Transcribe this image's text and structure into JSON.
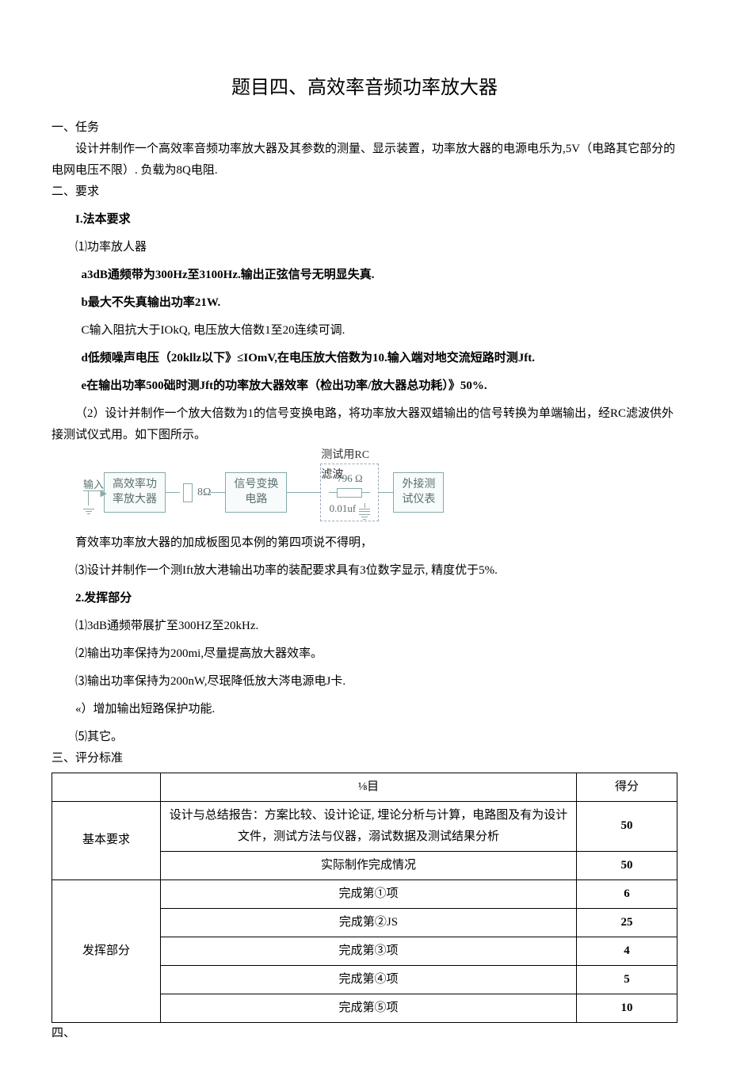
{
  "title": "题目四、高效率音频功率放大器",
  "s1": {
    "head": "一、任务",
    "p1": "设计并制作一个高效率音频功率放大器及其参数的测量、显示装置，功率放大器的电源电乐为,5V（电路其它部分的电网电压不限）. 负载为8Q电阻."
  },
  "s2": {
    "head": "二、要求",
    "basic": "I.法本要求",
    "i1": "⑴功率放人器",
    "a": "a3dB通频带为300Hz至3100Hz.输出正弦信号无明显失真.",
    "b": "b最大不失真输出功率21W.",
    "c": "C输入阻抗大于IOkQ, 电压放大倍数1至20连续可调.",
    "d": "d低频噪声电压（20kllz以下》≤IOmV,在电压放大倍数为10.输入端对地交流短路时测Jft.",
    "e": "e在输出功率500础时测Jft的功率放大器效率（检出功率/放大器总功耗）》50%.",
    "i2": "（2）设计并制作一个放大倍数为1的信号变换电路，将功率放大器双蜡输出的信号转换为单端输出，经RC滤波供外接测试仪式用。如下图所示。",
    "diag_note": "育效率功率放大器的加成板图见本例的第四项说不得明，",
    "i3": "⑶设计并制作一个测Ift放大港输出功率的装配要求具有3位数字显示, 精度优于5%.",
    "ext": "2.发挥部分",
    "e1": "⑴3dB通频带展扩至300HZ至20kHz.",
    "e2": "⑵输出功率保持为200mi,尽量提高放大器效率。",
    "e3": "⑶输出功率保持为200nW,尽珉降低放大涔电源电J卡.",
    "e4": "«）增加输出短路保护功能.",
    "e5": "⑸其它。"
  },
  "diagram": {
    "input": "输入",
    "amp": "高效率功\n率放大器",
    "load": "8Ω",
    "conv": "信号变换\n电路",
    "rc_title": "测试用RC滤波",
    "rc_r": "796 Ω",
    "rc_c": "0.01uf",
    "meter": "外接测\n试仪表"
  },
  "s3": {
    "head": "三、评分标准",
    "col_item": "⅛目",
    "col_score": "得分",
    "row_basic": "基本要求",
    "basic1": "设计与总结报告：方案比较、设计论证, 埋论分析与计算，电路图及有为设计文件，测试方法与仪器，溺试数据及测试结果分析",
    "basic1_score": "50",
    "basic2": "实际制作完成情况",
    "basic2_score": "50",
    "row_ext": "发挥部分",
    "ext1": "完成第①项",
    "ext1_score": "6",
    "ext2": "完成第②JS",
    "ext2_score": "25",
    "ext3": "完成第③项",
    "ext3_score": "4",
    "ext4": "完成第④项",
    "ext4_score": "5",
    "ext5": "完成第⑤项",
    "ext5_score": "10"
  },
  "s4": {
    "head": "四、"
  }
}
